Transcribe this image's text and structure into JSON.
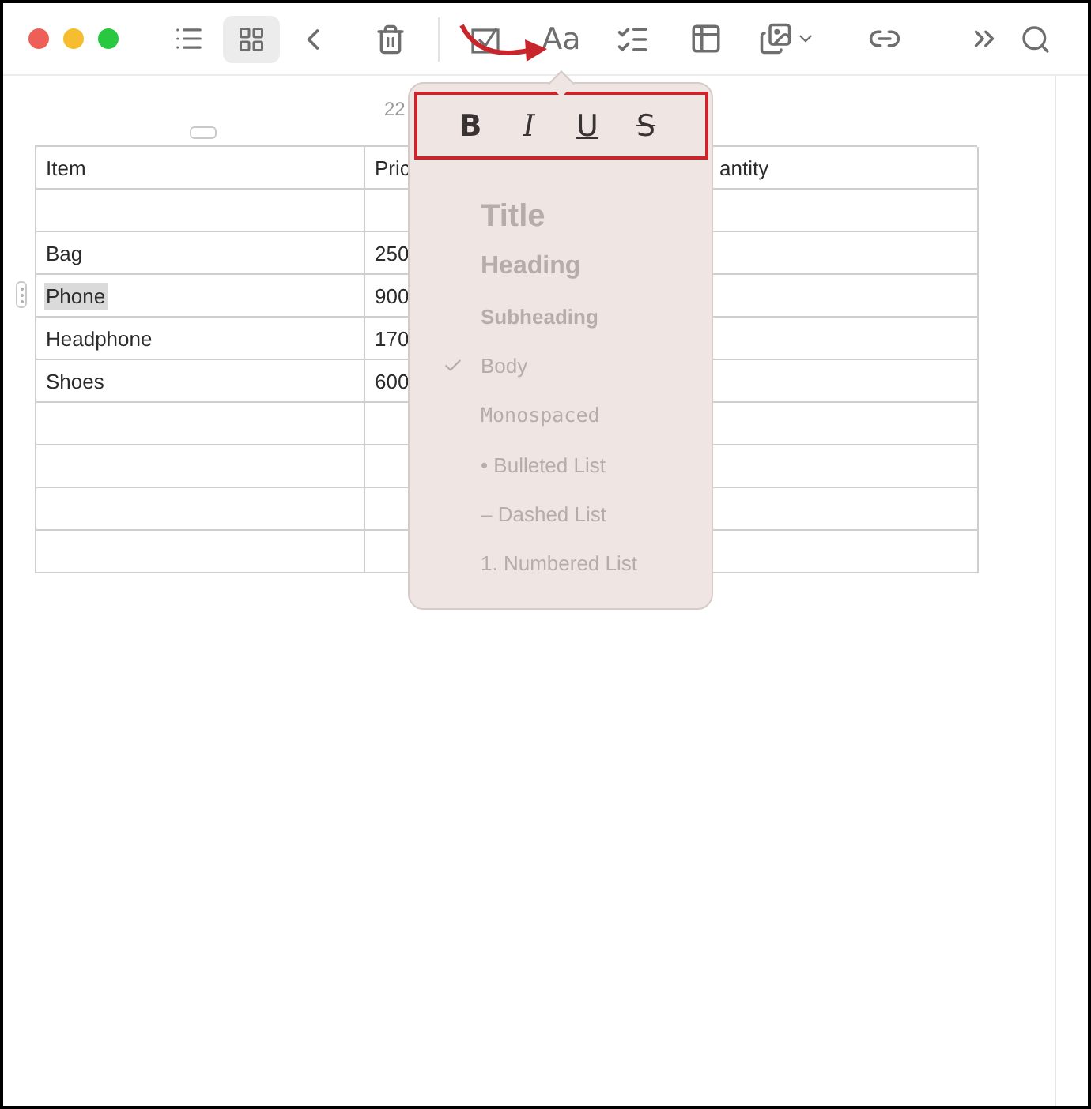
{
  "toolbar": {
    "view_buttons": [
      {
        "kind": "list",
        "selected": false
      },
      {
        "kind": "grid",
        "selected": true
      }
    ],
    "format_button": "Aa"
  },
  "date": "22",
  "table": {
    "columns": [
      "Item",
      "Pric",
      "antity"
    ],
    "rows": [
      {},
      {
        "item": "Bag",
        "price": "250",
        "selected": false
      },
      {
        "item": "Phone",
        "price": "900",
        "selected": true
      },
      {
        "item": "Headphone",
        "price": "170",
        "selected": false
      },
      {
        "item": "Shoes",
        "price": "600",
        "selected": false
      },
      {},
      {},
      {},
      {}
    ]
  },
  "format_popup": {
    "text_styles": [
      {
        "label": "B",
        "kind": "bold"
      },
      {
        "label": "I",
        "kind": "italic"
      },
      {
        "label": "U",
        "kind": "underline"
      },
      {
        "label": "S",
        "kind": "strikethrough"
      }
    ],
    "paragraph_styles": [
      {
        "label": "Title",
        "kind": "title",
        "selected": false
      },
      {
        "label": "Heading",
        "kind": "heading",
        "selected": false
      },
      {
        "label": "Subheading",
        "kind": "subheading",
        "selected": false
      },
      {
        "label": "Body",
        "kind": "body",
        "selected": true
      },
      {
        "label": "Monospaced",
        "kind": "mono",
        "selected": false
      },
      {
        "label": "• Bulleted List",
        "kind": "body",
        "selected": false
      },
      {
        "label": "– Dashed List",
        "kind": "body",
        "selected": false
      },
      {
        "label": "1. Numbered List",
        "kind": "body",
        "selected": false
      }
    ]
  }
}
